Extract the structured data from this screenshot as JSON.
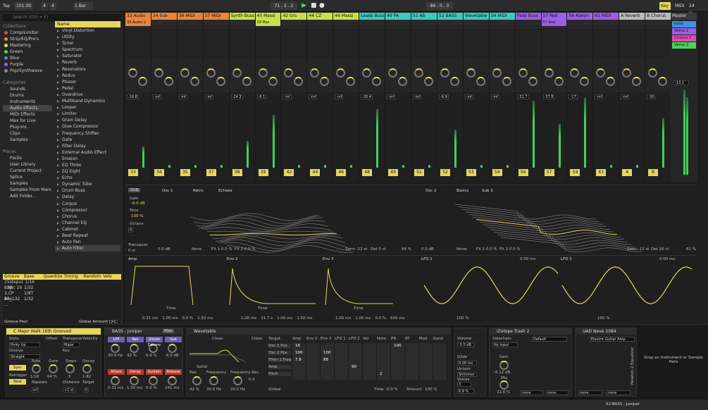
{
  "transport": {
    "tempo": "101.00",
    "sig_num": "4",
    "sig_den": "4",
    "quant": "1 Bar",
    "pos": "71 . 2 . 2",
    "end": "86 . 0 . 0",
    "key": "Key",
    "midi": "MIDI",
    "cpu": "24 %"
  },
  "browser": {
    "search_placeholder": "Search (Ctrl + F)",
    "collections_title": "Collections",
    "collections": [
      {
        "label": "Comp/Limiter",
        "color": "#d94c3c"
      },
      {
        "label": "Strip/EQ/Pre's",
        "color": "#e8853a"
      },
      {
        "label": "Mastering",
        "color": "#e6d65a"
      },
      {
        "label": "Green",
        "color": "#4ed35a"
      },
      {
        "label": "Blue",
        "color": "#4a8ae6"
      },
      {
        "label": "Purple",
        "color": "#9c5ee6"
      },
      {
        "label": "Pop/Synthwave",
        "color": "#888888"
      }
    ],
    "categories_title": "Categories",
    "categories": [
      "Sounds",
      "Drums",
      "Instruments",
      "Audio Effects",
      "MIDI Effects",
      "Max for Live",
      "Plug-Ins",
      "Clips",
      "Samples"
    ],
    "places_title": "Places",
    "places": [
      "Packs",
      "User Library",
      "Current Project",
      "Splice",
      "Samples",
      "Samples From Mars",
      "Add Folder..."
    ],
    "name_header": "Name",
    "items": [
      "Vinyl Distortion",
      "Utility",
      "Tuner",
      "Spectrum",
      "Saturator",
      "Reverb",
      "Resonators",
      "Redux",
      "Phaser",
      "Pedal",
      "Overdrive",
      "Multiband Dynamics",
      "Looper",
      "Limiter",
      "Grain Delay",
      "Glue Compressor",
      "Frequency Shifter",
      "Gate",
      "Filter Delay",
      "External Audio Effect",
      "Erosion",
      "EQ Three",
      "EQ Eight",
      "Echo",
      "Dynamic Tube",
      "Drum Buss",
      "Delay",
      "Corpus",
      "Compressor",
      "Chorus",
      "Channel EQ",
      "Cabinet",
      "Beat Repeat",
      "Auto Pan",
      "Auto Filter"
    ],
    "groove_headers": [
      "Groove Name",
      "Base",
      "Quantize",
      "Timing",
      "Random",
      "Velo"
    ],
    "groove_rows": [
      [
        "25steps1 130",
        "1/16",
        "",
        "",
        "",
        ""
      ],
      [
        "Logic 16 ...",
        "1/32",
        "",
        "",
        "",
        ""
      ],
      [
        "3 CP Boo...",
        "1/8T",
        "",
        "",
        "",
        ""
      ],
      [
        "AS_132 ...",
        "1/32",
        "",
        "",
        "",
        ""
      ]
    ],
    "groove_pool": "Groove Pool",
    "global_amount_label": "Global Amount",
    "global_amount": "12%"
  },
  "tracks": [
    {
      "name": "33 Audio",
      "color": "#e8853a",
      "clip": "33-Audio 2",
      "num": "33",
      "vol": "-16.8"
    },
    {
      "name": "34 Sub",
      "color": "#e8853a",
      "clip": "",
      "num": "34",
      "vol": "-inf"
    },
    {
      "name": "36 MIDI",
      "color": "#e8853a",
      "clip": "",
      "num": "35",
      "vol": "-inf"
    },
    {
      "name": "37 MIDI",
      "color": "#e8853a",
      "clip": "",
      "num": "37",
      "vol": "-inf"
    },
    {
      "name": "Synth Buss",
      "color": "#c8e04a",
      "clip": "",
      "num": "38",
      "vol": "-24.3"
    },
    {
      "name": "40 Massi",
      "color": "#c8e04a",
      "clip": "39 Mas",
      "num": "39",
      "vol": "-8.1"
    },
    {
      "name": "42 Grs",
      "color": "#c8e04a",
      "clip": "",
      "num": "42",
      "vol": "-inf"
    },
    {
      "name": "44 CZ",
      "color": "#c8e04a",
      "clip": "",
      "num": "44",
      "vol": "-inf"
    },
    {
      "name": "46 Massi",
      "color": "#c8e04a",
      "clip": "",
      "num": "46",
      "vol": "-inf"
    },
    {
      "name": "Leads Buss",
      "color": "#3ec8c0",
      "clip": "",
      "num": "48",
      "vol": "-20.4"
    },
    {
      "name": "49 PA",
      "color": "#3ec8c0",
      "clip": "",
      "num": "49",
      "vol": "-inf"
    },
    {
      "name": "51 Ab",
      "color": "#3ec8c0",
      "clip": "",
      "num": "51",
      "vol": "-inf"
    },
    {
      "name": "52 BASS",
      "color": "#3ec8c0",
      "clip": "",
      "num": "52",
      "vol": "-6.9"
    },
    {
      "name": "Wavetable",
      "color": "#3ec8c0",
      "clip": "",
      "num": "53",
      "vol": "-inf"
    },
    {
      "name": "54 MIDI",
      "color": "#3ec8c0",
      "clip": "",
      "num": "54",
      "vol": "-inf"
    },
    {
      "name": "Pads Buss",
      "color": "#9c5ee6",
      "clip": "",
      "num": "56",
      "vol": "-31.7"
    },
    {
      "name": "57 Red",
      "color": "#9c5ee6",
      "clip": "57-Red",
      "num": "57",
      "vol": "-57.8"
    },
    {
      "name": "58 Abeyn",
      "color": "#9c5ee6",
      "clip": "",
      "num": "59",
      "vol": "-17"
    },
    {
      "name": "61 MIDI",
      "color": "#9c5ee6",
      "clip": "",
      "num": "61",
      "vol": "-inf"
    },
    {
      "name": "A Reverb",
      "color": "#bbbbbb",
      "clip": "",
      "num": "A",
      "vol": "-inf"
    },
    {
      "name": "B Chorus",
      "color": "#bbbbbb",
      "clip": "",
      "num": "B",
      "vol": "-30"
    },
    {
      "name": "C Satura",
      "color": "#bbbbbb",
      "clip": "",
      "num": "C",
      "vol": "-inf"
    }
  ],
  "master": {
    "name": "Master",
    "scenes": [
      "Intro",
      "Verse 1",
      "Chorus 1",
      "Verse 2"
    ],
    "vol": "-13.1"
  },
  "osc1": {
    "title": "Osc 1",
    "bank": "Retro",
    "wave": "Echoes",
    "gain": "-6.0 dB",
    "tone": "100 %",
    "octave": "0",
    "transpose": "0 st",
    "level": "0.0 dB",
    "fx1": "FX 1 0.0 %",
    "fx2": "FX 2 0.0 %",
    "none": "None",
    "semi": "Semi -12 st",
    "det": "Det 5 ct",
    "pos": "64 %"
  },
  "osc2": {
    "title": "Osc 2",
    "bank": "Basics",
    "wave": "Sub 3",
    "level": "0.0 dB",
    "fx1": "FX 1 0.0 %",
    "fx2": "FX 2 0.0 %",
    "none": "None",
    "semi": "Semi -12 st",
    "det": "Det 16 ct",
    "pos": "81 %"
  },
  "env": {
    "amp": "Amp",
    "env2": "Env 2",
    "env3": "Env 3",
    "time": "Time",
    "slope": "Slope",
    "value": "Value",
    "amp_vals": [
      "0.31 ms",
      "1.00 ms",
      "0.0 %",
      "1.50 ms"
    ],
    "env2_vals": [
      "1.00 ms",
      "11.7 s",
      "1.00 ms",
      "1.50 ms"
    ],
    "env3_vals": [
      "1.00 ms",
      "1.00 ms",
      "0.0 %",
      "600 ms"
    ]
  },
  "lfo": {
    "lfo1": "LFO 1",
    "lfo2": "LFO 2",
    "rate": "0.00 ms",
    "amount": "100 %",
    "shape": "0.0 %",
    "offset": "0.0 %",
    "hz": "Hz"
  },
  "groove_panel": {
    "title": "C Major Walk 16th Grooved",
    "style": "Style",
    "style_val": "Pinky Up",
    "groove": "Groove",
    "groove_val": "Straight",
    "offset": "Offset",
    "transpose": "Transpose",
    "transpose_val": "Major",
    "key": "Key",
    "velocity": "Velocity",
    "rate": "Rate",
    "gate": "Gate",
    "steps": "Steps",
    "decay": "Decay",
    "sync": "Sync",
    "retrigger": "Retrigger",
    "beat": "Beat",
    "repeats": "Repeats",
    "distance": "Distance",
    "target": "Target",
    "rate_val": "1/16",
    "gate_val": "64 %",
    "steps_val": "3",
    "decay_val": "1.82",
    "repeats_val": "inf",
    "distance_val": "+1 st",
    "target_val": "0"
  },
  "bass": {
    "title": "BASS - Juniper",
    "map": "Map",
    "macros": [
      "LPF",
      "Res",
      "Voices Detune",
      "Sub",
      "Attack",
      "Decay",
      "Sustain",
      "Release"
    ],
    "macro_vals": [
      "30.9 Hz",
      "42 %",
      "6.9 %",
      "-6.0 dB",
      "0.31 ms",
      "1.50 ms",
      "0.0 %",
      "241 ms"
    ]
  },
  "wavetable": {
    "title": "Wavetable",
    "filter1": "Clean",
    "filter2": "Clean",
    "serial": "Serial",
    "res": "Res",
    "res_val": "42 %",
    "freq": "Frequency",
    "freq_val": "30.9 Hz",
    "freq_res": "Frequency Res",
    "freq_res_val": "20.0 Hz",
    "freq_res2": "0.0",
    "mod_cols": [
      "Target",
      "Amp",
      "Env 2",
      "Env 3",
      "LFO 1",
      "LFO 2",
      "Vel",
      "Note",
      "PB",
      "AT",
      "Mod",
      "Rand"
    ],
    "mod_rows": [
      "Osc 1 Pos",
      "Osc 2 Pos",
      "Filter 1 Freq",
      "Amp",
      "Pitch"
    ],
    "mod_vals": [
      "16",
      "100",
      "100",
      "7.8",
      "88",
      "90",
      "2",
      "100"
    ],
    "global": "Global",
    "time": "Time",
    "time_val": "0.0 %",
    "amount": "Amount",
    "amount_val": "100 %",
    "volume": "Volume",
    "volume_val": "-5.0 dB",
    "glide": "Glide",
    "glide_val": "0.00 ms",
    "unison": "Unison",
    "unison_val": "Shimmer",
    "voices": "Voices",
    "voices_val": "3",
    "unison_amt": "6.9 %"
  },
  "izotope": {
    "title": "iZotope Trash 2",
    "sidechain": "Sidechain",
    "input": "No Input",
    "default": "Default",
    "gain": "Gain",
    "gain_val": "-6.12 dB",
    "mix": "Mix",
    "mix_val": "31.6 %",
    "none": "none"
  },
  "uad": {
    "title": "UAD Neve 1084",
    "preset": "Electric Guitar Amp",
    "none": "none",
    "label": "Newton 2 Equalizer"
  },
  "drop": "Drop an Instrument or Sample Here",
  "status": {
    "track": "52-BASS - Juniper"
  }
}
